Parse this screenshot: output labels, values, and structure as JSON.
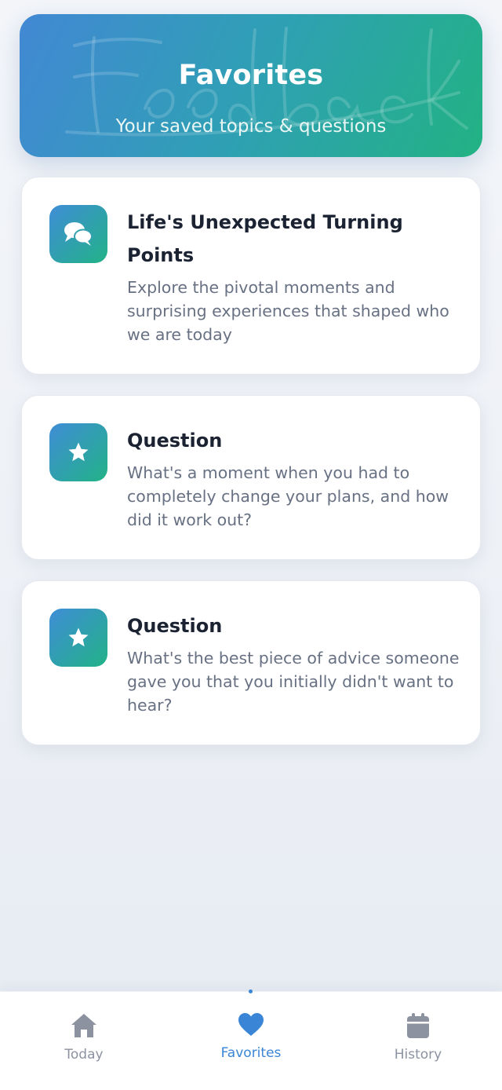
{
  "header": {
    "title": "Favorites",
    "subtitle": "Your saved topics & questions",
    "background_watermark": "feedback"
  },
  "favorites": [
    {
      "icon": "chat-bubbles-icon",
      "title": "Life's Unexpected Turning Points",
      "description": "Explore the pivotal moments and surprising experiences that shaped who we are today"
    },
    {
      "icon": "star-icon",
      "title": "Question",
      "description": "What's a moment when you had to completely change your plans, and how did it work out?"
    },
    {
      "icon": "star-icon",
      "title": "Question",
      "description": "What's the best piece of advice someone gave you that you initially didn't want to hear?"
    }
  ],
  "nav": {
    "items": [
      {
        "label": "Today",
        "icon": "home-icon",
        "active": false
      },
      {
        "label": "Favorites",
        "icon": "heart-icon",
        "active": true
      },
      {
        "label": "History",
        "icon": "calendar-icon",
        "active": false
      }
    ]
  },
  "colors": {
    "accent": "#3a85d6",
    "gradient_start": "#4288d4",
    "gradient_end": "#22b283",
    "inactive_nav": "#8c92a0",
    "title_text": "#1b2333",
    "body_text": "#687183"
  }
}
